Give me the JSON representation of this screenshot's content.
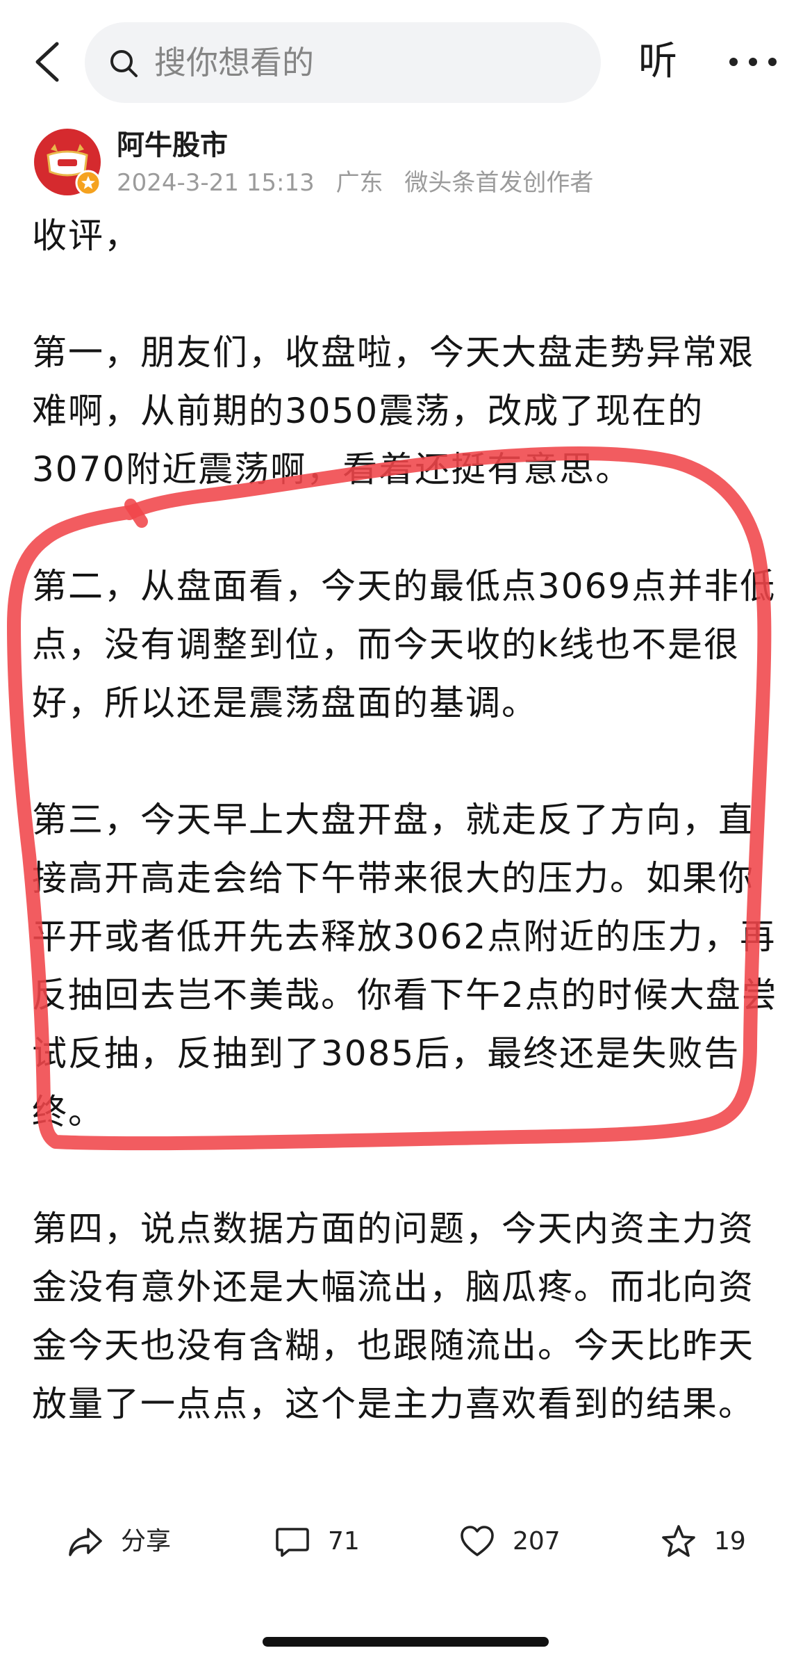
{
  "header": {
    "back_icon": "chevron-left-icon",
    "search_icon": "search-icon",
    "search_placeholder": "搜你想看的",
    "listen_label": "听",
    "more_icon": "more-dots-icon"
  },
  "author": {
    "avatar_icon": "avatar",
    "badge_icon": "verified-creator-badge-icon",
    "name": "阿牛股市",
    "publish_time": "2024-3-21 15:13",
    "location": "广东",
    "creator_tag": "微头条首发创作者"
  },
  "post": {
    "paragraphs": [
      {
        "lines": [
          "收评，"
        ]
      },
      {
        "lines": [
          "第一，朋友们，收盘啦，今天大盘走势异常艰",
          "难啊，从前期的3050震荡，改成了现在的",
          "3070附近震荡啊，看着还挺有意思。"
        ]
      },
      {
        "lines": [
          "第二，从盘面看，今天的最低点3069点并非低",
          "点，没有调整到位，而今天收的k线也不是很",
          "好，所以还是震荡盘面的基调。"
        ]
      },
      {
        "lines": [
          "第三，今天早上大盘开盘，就走反了方向，直",
          "接高开高走会给下午带来很大的压力。如果你",
          "平开或者低开先去释放3062点附近的压力，再",
          "反抽回去岂不美哉。你看下午2点的时候大盘尝",
          "试反抽，反抽到了3085后，最终还是失败告",
          "终。"
        ]
      },
      {
        "lines": [
          "第四，说点数据方面的问题，今天内资主力资",
          "金没有意外还是大幅流出，脑瓜疼。而北向资",
          "金今天也没有含糊，也跟随流出。今天比昨天",
          "放量了一点点，这个是主力喜欢看到的结果。"
        ]
      }
    ]
  },
  "actions": {
    "share_icon": "share-icon",
    "share_label": "分享",
    "comment_icon": "comment-icon",
    "comment_count": 71,
    "like_icon": "heart-icon",
    "like_count": 207,
    "favorite_icon": "star-icon",
    "favorite_count": 19
  },
  "colors": {
    "annotation_stroke": "#f0454a",
    "avatar_red": "#d52a2e",
    "avatar_gold": "#e9b84a",
    "badge_orange": "#f5a21f",
    "text": "#151515",
    "meta_gray": "#9b9b9b",
    "search_bg": "#f2f3f5"
  }
}
